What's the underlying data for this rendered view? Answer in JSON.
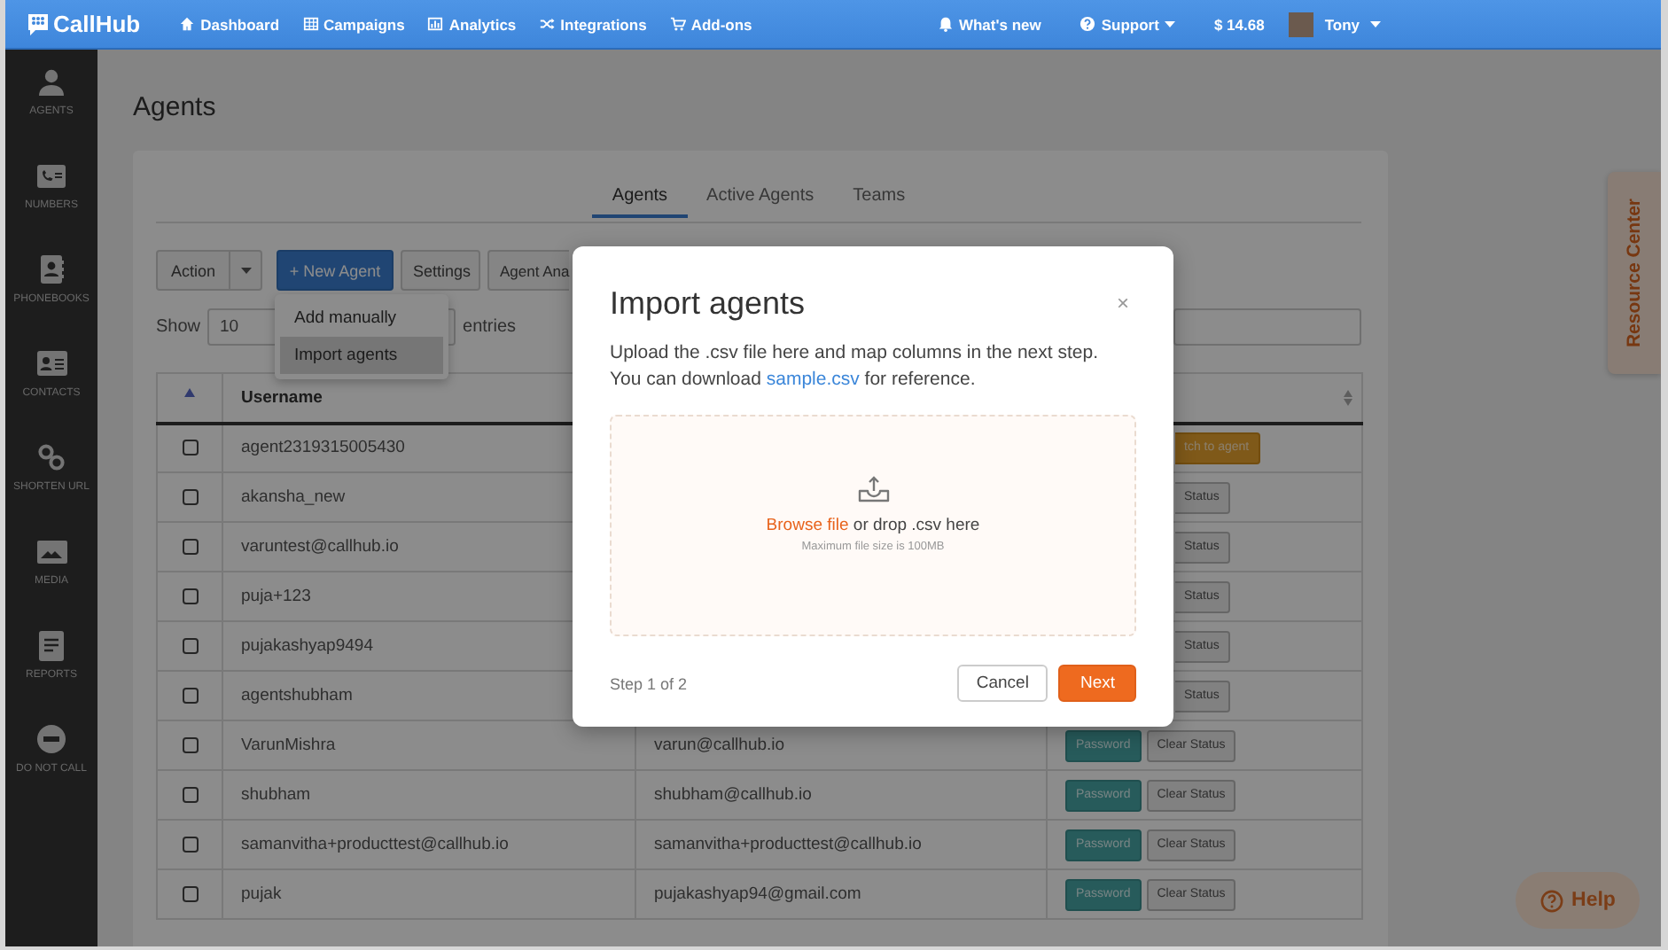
{
  "nav": {
    "logo": "CallHub",
    "items": [
      {
        "label": "Dashboard"
      },
      {
        "label": "Campaigns"
      },
      {
        "label": "Analytics"
      },
      {
        "label": "Integrations"
      },
      {
        "label": "Add-ons"
      }
    ],
    "whats_new": "What's new",
    "support": "Support",
    "balance": "$ 14.68",
    "user": "Tony"
  },
  "sidebar": {
    "items": [
      {
        "label": "AGENTS"
      },
      {
        "label": "NUMBERS"
      },
      {
        "label": "PHONEBOOKS"
      },
      {
        "label": "CONTACTS"
      },
      {
        "label": "SHORTEN URL"
      },
      {
        "label": "MEDIA"
      },
      {
        "label": "REPORTS"
      },
      {
        "label": "DO NOT CALL"
      }
    ]
  },
  "page_title": "Agents",
  "tabs": [
    {
      "label": "Agents",
      "selected": true
    },
    {
      "label": "Active Agents",
      "selected": false
    },
    {
      "label": "Teams",
      "selected": false
    }
  ],
  "toolbar": {
    "action": "Action",
    "new_agent": "+ New Agent",
    "settings": "Settings",
    "analytics": "Agent Ana"
  },
  "dropdown": {
    "items": [
      {
        "label": "Add manually",
        "selected": false
      },
      {
        "label": "Import agents",
        "selected": true
      }
    ]
  },
  "length": {
    "before": "Show",
    "value": "10",
    "after": "entries"
  },
  "table": {
    "columns": [
      "Username"
    ],
    "rows": [
      {
        "checked": false,
        "username": "agent2319315005430",
        "cut": true,
        "actions": [
          {
            "kind": "switch",
            "label": "tch to agent"
          }
        ]
      },
      {
        "checked": false,
        "username": "akansha_new",
        "cut": true,
        "actions": [
          {
            "kind": "clear",
            "label": "Status"
          }
        ]
      },
      {
        "checked": false,
        "username": "varuntest@callhub.io",
        "cut": true,
        "actions": [
          {
            "kind": "clear",
            "label": "Status"
          }
        ]
      },
      {
        "checked": false,
        "username": "puja+123",
        "cut": true,
        "actions": [
          {
            "kind": "clear",
            "label": "Status"
          }
        ]
      },
      {
        "checked": false,
        "username": "pujakashyap9494",
        "cut": true,
        "actions": [
          {
            "kind": "clear",
            "label": "Status"
          }
        ]
      },
      {
        "checked": false,
        "username": "agentshubham",
        "cut": true,
        "actions": [
          {
            "kind": "clear",
            "label": "Status"
          }
        ]
      },
      {
        "checked": false,
        "username": "VarunMishra",
        "email": "varun@callhub.io",
        "cut": false,
        "actions": [
          {
            "kind": "password",
            "label": "Password"
          },
          {
            "kind": "clear",
            "label": "Clear Status"
          }
        ]
      },
      {
        "checked": false,
        "username": "shubham",
        "email": "shubham@callhub.io",
        "cut": false,
        "actions": [
          {
            "kind": "password",
            "label": "Password"
          },
          {
            "kind": "clear",
            "label": "Clear Status"
          }
        ]
      },
      {
        "checked": false,
        "username": "samanvitha+producttest@callhub.io",
        "email": "samanvitha+producttest@callhub.io",
        "cut": false,
        "actions": [
          {
            "kind": "password",
            "label": "Password"
          },
          {
            "kind": "clear",
            "label": "Clear Status"
          }
        ]
      },
      {
        "checked": false,
        "username": "pujak",
        "email": "pujakashyap94@gmail.com",
        "cut": false,
        "actions": [
          {
            "kind": "password",
            "label": "Password"
          },
          {
            "kind": "clear",
            "label": "Clear Status"
          }
        ]
      }
    ]
  },
  "resource_center": "Resource Center",
  "help": "Help",
  "modal": {
    "title": "Import agents",
    "close": "×",
    "line1": "Upload the .csv file here and map columns in the next step.",
    "line2_before": "You can download ",
    "link": "sample.csv",
    "line2_after": " for reference.",
    "browse": "Browse file",
    "drop": " or drop .csv here",
    "hint": "Maximum file size is 100MB",
    "step": "Step 1 of 2",
    "cancel": "Cancel",
    "next": "Next"
  }
}
